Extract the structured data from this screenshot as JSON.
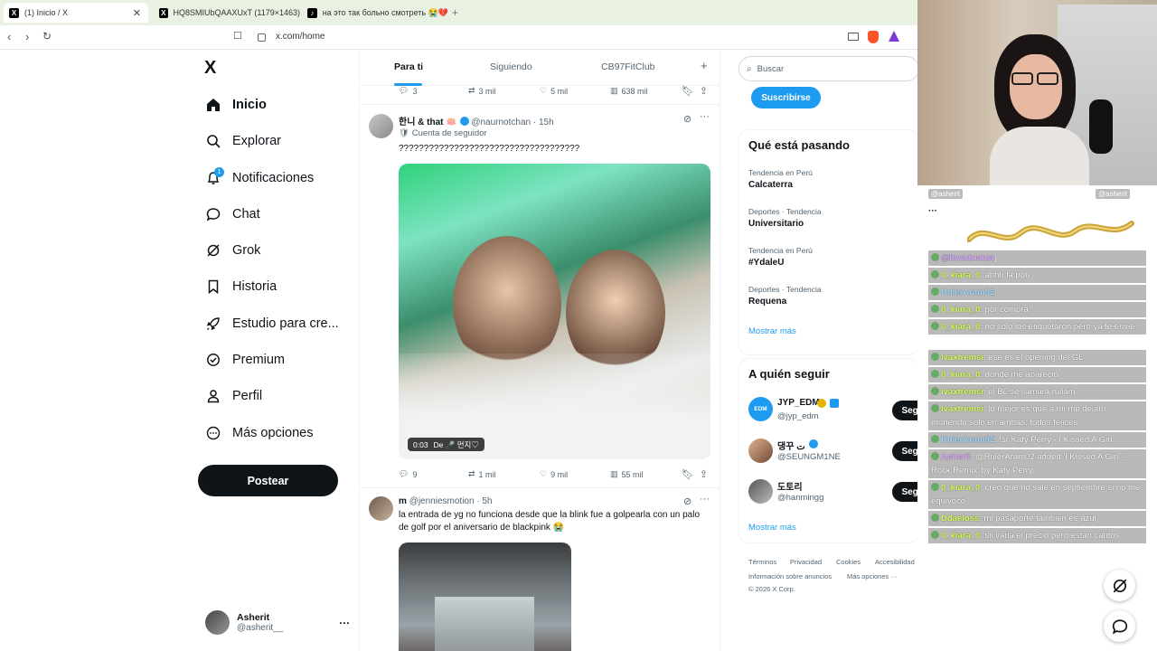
{
  "browser": {
    "tabs": [
      {
        "label": "(1) Inicio / X",
        "favicon": "X"
      },
      {
        "label": "HQ8SMIUbQAAXUxT (1179×1463)",
        "favicon": "X"
      },
      {
        "label": "на это так больно смотреть 😭💔",
        "favicon": "♪"
      }
    ],
    "new_tab": "+",
    "url": "x.com/home"
  },
  "nav": {
    "logo": "X",
    "items": [
      {
        "label": "Inicio",
        "icon": "home-icon"
      },
      {
        "label": "Explorar",
        "icon": "search-icon"
      },
      {
        "label": "Notificaciones",
        "icon": "bell-icon",
        "badge": "1"
      },
      {
        "label": "Chat",
        "icon": "chat-icon"
      },
      {
        "label": "Grok",
        "icon": "grok-icon"
      },
      {
        "label": "Historia",
        "icon": "bookmark-icon"
      },
      {
        "label": "Estudio para cre...",
        "icon": "rocket-icon"
      },
      {
        "label": "Premium",
        "icon": "premium-icon"
      },
      {
        "label": "Perfil",
        "icon": "person-icon"
      },
      {
        "label": "Más opciones",
        "icon": "more-icon"
      }
    ],
    "post_label": "Postear",
    "profile": {
      "name": "Asherit",
      "handle": "@asherit__",
      "more": "···"
    }
  },
  "feed": {
    "tabs": [
      "Para ti",
      "Siguiendo",
      "CB97FitClub"
    ],
    "add_tab": "+",
    "prev_actions": {
      "replies": "3",
      "reposts": "3 mil",
      "likes": "5 mil",
      "views": "638 mil"
    },
    "tweets": [
      {
        "name": "한니 & that 🪷",
        "handle": "@naurnotchan",
        "time": "· 15h",
        "context": "Cuenta de seguidor",
        "text": "????????????????????????????????????",
        "video_time": "0:03",
        "video_caption": "De 🎤 먼지♡",
        "actions": {
          "replies": "9",
          "reposts": "1 mil",
          "likes": "9 mil",
          "views": "55 mil"
        }
      },
      {
        "name": "m",
        "handle": "@jenniesmotion",
        "time": "· 5h",
        "text": "la entrada de yg no funciona desde que la blink fue a golpearla con un palo de golf por el aniversario de blackpink 😭"
      }
    ],
    "more": "···"
  },
  "sidebar": {
    "search_placeholder": "Buscar",
    "subscribe_label": "Suscribirse",
    "trends_title": "Qué está pasando",
    "trends": [
      {
        "meta": "Tendencia en Perú",
        "name": "Calcaterra"
      },
      {
        "meta": "Deportes · Tendencia",
        "name": "Universitario"
      },
      {
        "meta": "Tendencia en Perú",
        "name": "#YdaleU"
      },
      {
        "meta": "Deportes · Tendencia",
        "name": "Requena"
      }
    ],
    "show_more": "Mostrar más",
    "who_title": "A quién seguir",
    "follow": [
      {
        "name": "JYP_EDM",
        "handle": "@jyp_edm",
        "avatar": "EDM"
      },
      {
        "name": "댕꾸 ت",
        "handle": "@SEUNGM1NE",
        "avatar": ""
      },
      {
        "name": "도토리",
        "handle": "@hanmingg",
        "avatar": ""
      }
    ],
    "follow_label": "Seguir",
    "show_more_2": "Mostrar más",
    "footer": [
      "Términos",
      "Privacidad",
      "Cookies",
      "Accesibilidad",
      "Información sobre anuncios",
      "Más opciones ···",
      "© 2026 X Corp."
    ]
  },
  "stream_chat": {
    "top_names": [
      "@asherit",
      "@asherit"
    ],
    "more": "···",
    "lines": [
      {
        "name": "@lbwxtremsl",
        "text": ")",
        "name_color": "purple"
      },
      {
        "name": "0_kiara_0",
        "text": ": ahhh la pob"
      },
      {
        "name": "RulerAram02",
        "text": ": ",
        "name_color": "blue"
      },
      {
        "name": "0_kiara_0",
        "text": ": por compra"
      },
      {
        "name": "0_kiara_0",
        "text": ": no solo los etiquetaron pero ya te envié"
      },
      {
        "name": "lvaxtremsi",
        "text": ": ese es el opening del GL"
      },
      {
        "name": "0_kiara_0",
        "text": ": donde me apareció"
      },
      {
        "name": "lvaxtremsi",
        "text": ": el BL se llamara rullam"
      },
      {
        "name": "lvaxtremsi",
        "text": ": lo mejor es que a mi me dejam muriendo solo en ambas, todos felices"
      },
      {
        "name": "RulerAram02",
        "text": ": !sr Katy Perry - I Kissed A Girl",
        "name_color": "blue"
      },
      {
        "name": "Asherit",
        "text": ": @RulerAram02 added 'I Kissed A Girl - Rock Remix' by Katy Perry.",
        "name_color": "purple"
      },
      {
        "name": "0_kiara_0",
        "text": ": creo que no sale en septiembre si no me equivoco"
      },
      {
        "name": "Ddaeloss",
        "text": ": mi pasaporte tambien es azul"
      },
      {
        "name": "0_kiara_0",
        "text": ": sii varia el precio pero están caritos"
      }
    ]
  },
  "colors": {
    "accent": "#1d9bf0",
    "text": "#0f1419",
    "muted": "#536471",
    "tabstrip": "#e9f1e3"
  }
}
